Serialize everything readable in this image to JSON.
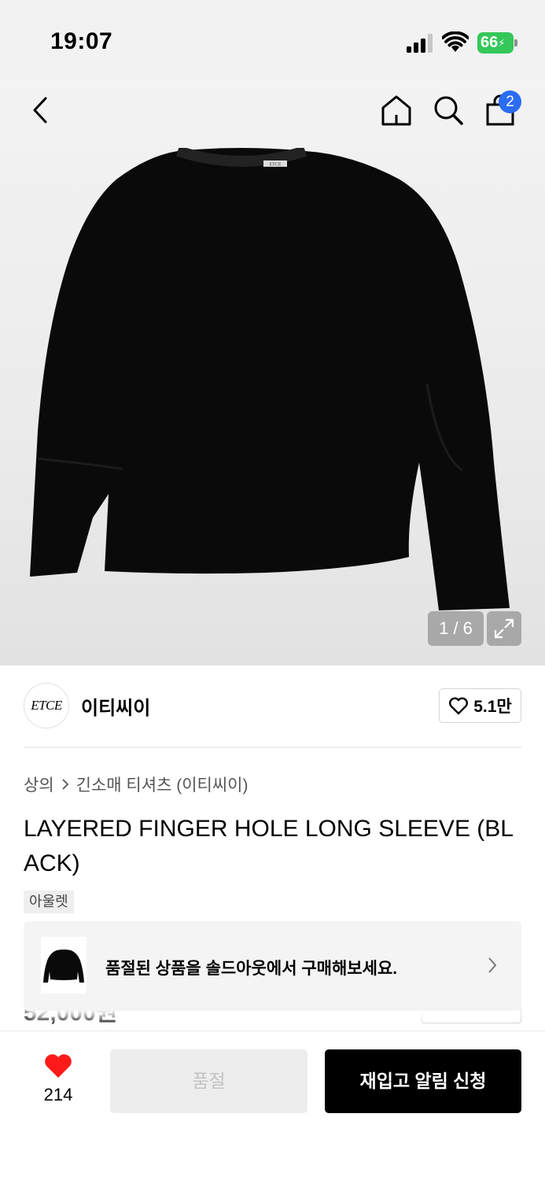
{
  "status_bar": {
    "time": "19:07",
    "battery_level": "66",
    "battery_color": "#34c759"
  },
  "header": {
    "back_icon": "chevron-left-icon",
    "home_icon": "home-icon",
    "search_icon": "search-icon",
    "cart_icon": "shopping-bag-icon",
    "cart_badge": "2",
    "badge_color": "#2b6cf3"
  },
  "gallery": {
    "page_indicator": "1 / 6",
    "expand_icon": "expand-icon",
    "shirt_neck_label": "ETCE"
  },
  "brand": {
    "logo_text": "ETCE",
    "name": "이티씨이",
    "like_count": "5.1만"
  },
  "product": {
    "breadcrumb": [
      "상의",
      "긴소매 티셔츠 (이티씨이)"
    ],
    "title": "LAYERED FINGER HOLE LONG SLEEVE (BLACK)",
    "tag": "아울렛"
  },
  "soldout_banner": {
    "text": "품절된 상품을 솔드아웃에서 구매해보세요."
  },
  "bottom_bar": {
    "wish_count": "214",
    "soldout_label": "품절",
    "restock_label": "재입고 알림 신청",
    "heart_color": "#ff1a1a"
  }
}
